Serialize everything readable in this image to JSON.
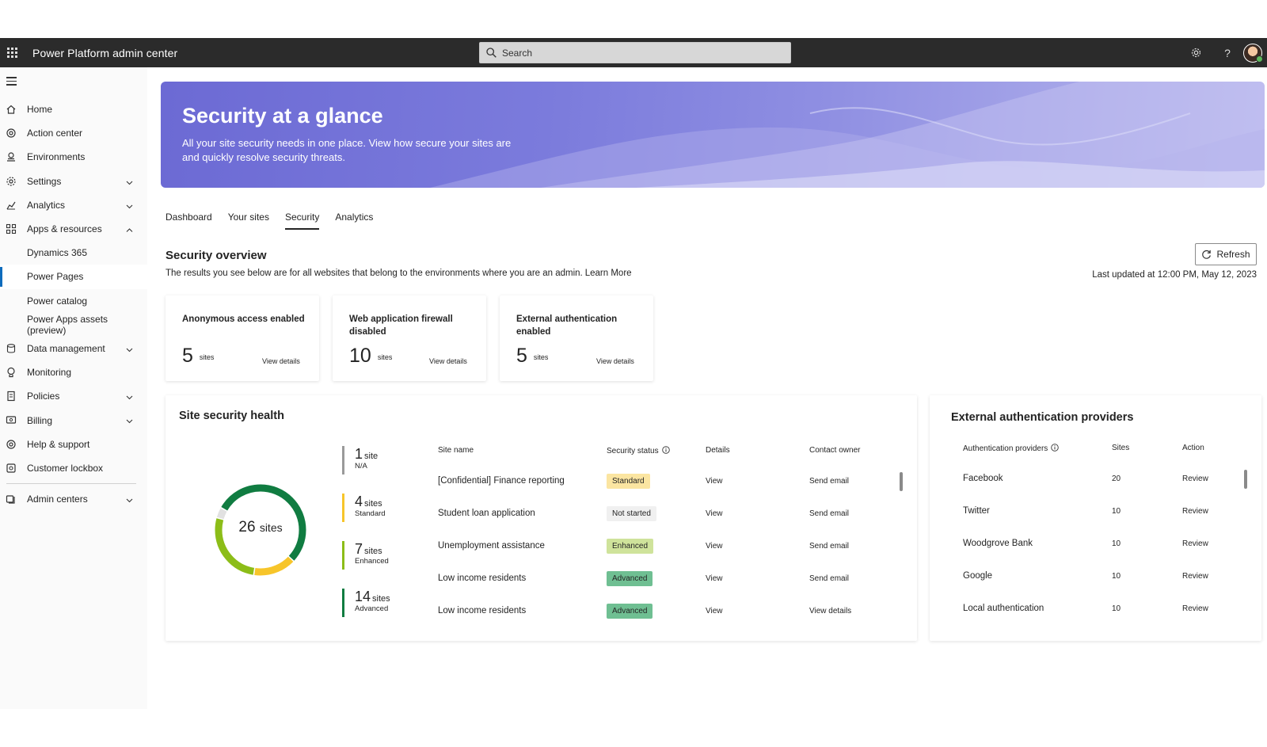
{
  "app": {
    "title": "Power Platform admin center"
  },
  "search": {
    "placeholder": "Search"
  },
  "topbar_icons": [
    "settings-icon",
    "help-icon",
    "avatar"
  ],
  "sidebar": {
    "items": [
      {
        "label": "Home",
        "icon": "home-icon"
      },
      {
        "label": "Action center",
        "icon": "action-center-icon"
      },
      {
        "label": "Environments",
        "icon": "environments-icon"
      },
      {
        "label": "Settings",
        "icon": "gear-icon",
        "expand": "down"
      },
      {
        "label": "Analytics",
        "icon": "analytics-icon",
        "expand": "down"
      },
      {
        "label": "Apps & resources",
        "icon": "apps-icon",
        "expand": "up"
      },
      {
        "label": "Dynamics 365",
        "sub": true
      },
      {
        "label": "Power Pages",
        "sub": true,
        "active": true
      },
      {
        "label": "Power catalog",
        "sub": true
      },
      {
        "label": "Power Apps assets (preview)",
        "sub": true
      },
      {
        "label": "Data management",
        "icon": "data-icon",
        "expand": "down"
      },
      {
        "label": "Monitoring",
        "icon": "monitoring-icon"
      },
      {
        "label": "Policies",
        "icon": "policies-icon",
        "expand": "down"
      },
      {
        "label": "Billing",
        "icon": "billing-icon",
        "expand": "down"
      },
      {
        "label": "Help & support",
        "icon": "help-support-icon"
      },
      {
        "label": "Customer lockbox",
        "icon": "lockbox-icon"
      },
      {
        "label": "Admin centers",
        "icon": "admin-centers-icon",
        "expand": "down"
      }
    ]
  },
  "banner": {
    "title": "Security at a glance",
    "subtitle": "All your site security needs in one place. View how secure your sites are and quickly resolve security threats."
  },
  "tabs": [
    {
      "label": "Dashboard"
    },
    {
      "label": "Your sites"
    },
    {
      "label": "Security",
      "active": true
    },
    {
      "label": "Analytics"
    }
  ],
  "overview": {
    "title": "Security overview",
    "description": "The results you see below are for all websites that belong to the environments where you are an admin.",
    "learn_more": "Learn More",
    "refresh_label": "Refresh",
    "last_updated": "Last updated at 12:00 PM, May 12, 2023"
  },
  "stat_cards": [
    {
      "title": "Anonymous access enabled",
      "value": "5",
      "unit": "sites",
      "link": "View details"
    },
    {
      "title": "Web application firewall disabled",
      "value": "10",
      "unit": "sites",
      "link": "View details"
    },
    {
      "title": "External authentication enabled",
      "value": "5",
      "unit": "sites",
      "link": "View details"
    }
  ],
  "health": {
    "title": "Site security health",
    "total_num": "26",
    "total_unit": "sites",
    "legend": [
      {
        "num": "1",
        "unit": "site",
        "category": "N/A",
        "color": "#e1e1e1"
      },
      {
        "num": "4",
        "unit": "sites",
        "category": "Standard",
        "color": "#f7c52a"
      },
      {
        "num": "7",
        "unit": "sites",
        "category": "Enhanced",
        "color": "#8cbd18"
      },
      {
        "num": "14",
        "unit": "sites",
        "category": "Advanced",
        "color": "#107c41"
      }
    ],
    "columns": [
      "Site name",
      "Security status",
      "Details",
      "Contact owner"
    ],
    "rows": [
      {
        "site": "[Confidential] Finance reporting",
        "status": "Standard",
        "details": "View",
        "contact": "Send email"
      },
      {
        "site": "Student loan application",
        "status": "Not started",
        "details": "View",
        "contact": "Send email"
      },
      {
        "site": "Unemployment assistance",
        "status": "Enhanced",
        "details": "View",
        "contact": "Send email"
      },
      {
        "site": "Low income residents",
        "status": "Advanced",
        "details": "View",
        "contact": "Send email"
      },
      {
        "site": "Low income residents",
        "status": "Advanced",
        "details": "View",
        "contact": "View details"
      }
    ],
    "status_colors": {
      "Standard": "#fbe5a1",
      "Not started": "#f0f0f0",
      "Enhanced": "#cfe39b",
      "Advanced": "#6fbf92"
    }
  },
  "auth_providers": {
    "title": "External authentication providers",
    "columns": [
      "Authentication providers",
      "Sites",
      "Action"
    ],
    "rows": [
      {
        "name": "Facebook",
        "sites": "20",
        "action": "Review"
      },
      {
        "name": "Twitter",
        "sites": "10",
        "action": "Review"
      },
      {
        "name": "Woodgrove Bank",
        "sites": "10",
        "action": "Review"
      },
      {
        "name": "Google",
        "sites": "10",
        "action": "Review"
      },
      {
        "name": "Local authentication",
        "sites": "10",
        "action": "Review"
      }
    ]
  }
}
